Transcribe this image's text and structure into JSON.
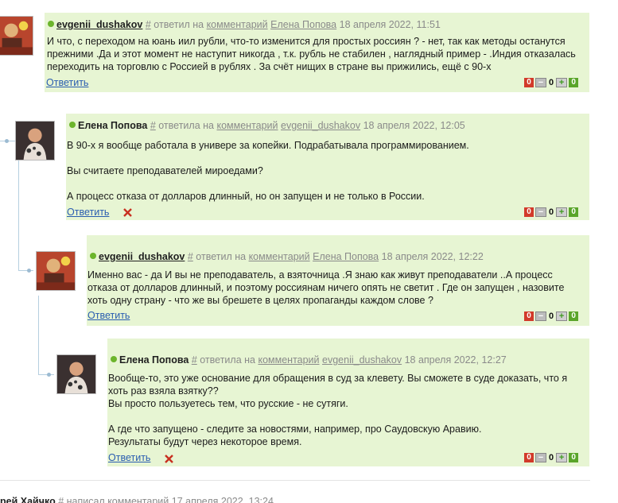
{
  "comments": [
    {
      "author": "evgenii_dushakov",
      "hash": "#",
      "action": "ответил на",
      "comment_link": "комментарий",
      "target": "Елена Попова",
      "date": "18 апреля 2022, 11:51",
      "body": [
        "И что, с переходом на юань иил рубли, что-то изменится для простых россиян ? - нет, так как методы останутся прежними .Да и этот момент не наступит никогда , т.к. рубль не стабилен , наглядный пример - .Индия отказалась переходить на торговлю с Россией в рублях . За счёт нищих в стране вы прижились, ещё с 90-х"
      ],
      "reply_label": "Ответить",
      "votes": {
        "minus_count": "0",
        "score": "0",
        "plus_count": "0"
      }
    },
    {
      "author": "Елена Попова",
      "hash": "#",
      "action": "ответила на",
      "comment_link": "комментарий",
      "target": "evgenii_dushakov",
      "date": "18 апреля 2022, 12:05",
      "body": [
        "В 90-х я вообще работала в универе за копейки. Подрабатывала программированием.",
        "",
        "Вы считаете преподавателей мироедами?",
        "",
        "А процесс отказа от долларов длинный, но он запущен и не только в России."
      ],
      "reply_label": "Ответить",
      "votes": {
        "minus_count": "0",
        "score": "0",
        "plus_count": "0"
      }
    },
    {
      "author": "evgenii_dushakov",
      "hash": "#",
      "action": "ответил на",
      "comment_link": "комментарий",
      "target": "Елена Попова",
      "date": "18 апреля 2022, 12:22",
      "body": [
        "Именно вас - да И вы не преподаватель, а взяточница .Я знаю как живут преподаватели ..А процесс отказа от долларов длинный, и поэтому россиянам ничего опять не светит . Где он запущен , назовите хоть одну страну - что же вы брешете в целях пропаганды каждом слове ?"
      ],
      "reply_label": "Ответить",
      "votes": {
        "minus_count": "0",
        "score": "0",
        "plus_count": "0"
      }
    },
    {
      "author": "Елена Попова",
      "hash": "#",
      "action": "ответила на",
      "comment_link": "комментарий",
      "target": "evgenii_dushakov",
      "date": "18 апреля 2022, 12:27",
      "body": [
        "Вообще-то, это уже основание для обращения в суд за клевету. Вы сможете в суде доказать, что я хоть раз взяла взятку??",
        "Вы просто пользуетесь тем, что русские - не сутяги.",
        "",
        "А где что запущено - следите за новостями, например, про Саудовскую Аравию.",
        "Результаты будут через некоторое время."
      ],
      "reply_label": "Ответить",
      "votes": {
        "minus_count": "0",
        "score": "0",
        "plus_count": "0"
      }
    }
  ],
  "partial_comment": {
    "author": "рей Хайчко",
    "hash": "#",
    "action": "написал комментарий",
    "date": "17 апреля 2022, 13:24"
  },
  "colors": {
    "bubble": "#e7f5d3",
    "online": "#6cb52c",
    "link": "#2a5db0",
    "vote_red": "#d23a2a",
    "vote_green": "#5aa52a"
  }
}
